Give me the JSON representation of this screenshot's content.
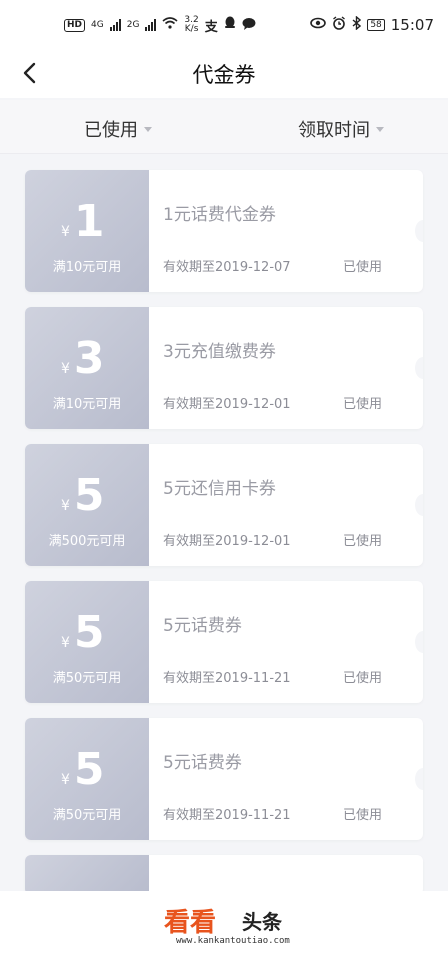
{
  "status_bar": {
    "hd": "HD",
    "net1": "4G",
    "net2": "2G",
    "speed_value": "3.2",
    "speed_unit": "K/s",
    "battery": "58",
    "time": "15:07"
  },
  "header": {
    "title": "代金券"
  },
  "filters": [
    {
      "label": "已使用"
    },
    {
      "label": "领取时间"
    }
  ],
  "coupons": [
    {
      "currency": "¥",
      "amount": "1",
      "condition": "满10元可用",
      "name": "1元话费代金券",
      "expiry": "有效期至2019-12-07",
      "status": "已使用"
    },
    {
      "currency": "¥",
      "amount": "3",
      "condition": "满10元可用",
      "name": "3元充值缴费券",
      "expiry": "有效期至2019-12-01",
      "status": "已使用"
    },
    {
      "currency": "¥",
      "amount": "5",
      "condition": "满500元可用",
      "name": "5元还信用卡券",
      "expiry": "有效期至2019-12-01",
      "status": "已使用"
    },
    {
      "currency": "¥",
      "amount": "5",
      "condition": "满50元可用",
      "name": "5元话费券",
      "expiry": "有效期至2019-11-21",
      "status": "已使用"
    },
    {
      "currency": "¥",
      "amount": "5",
      "condition": "满50元可用",
      "name": "5元话费券",
      "expiry": "有效期至2019-11-21",
      "status": "已使用"
    }
  ],
  "watermark": {
    "brand_a": "看看",
    "brand_b": "头条",
    "url": "www.kankantoutiao.com"
  }
}
